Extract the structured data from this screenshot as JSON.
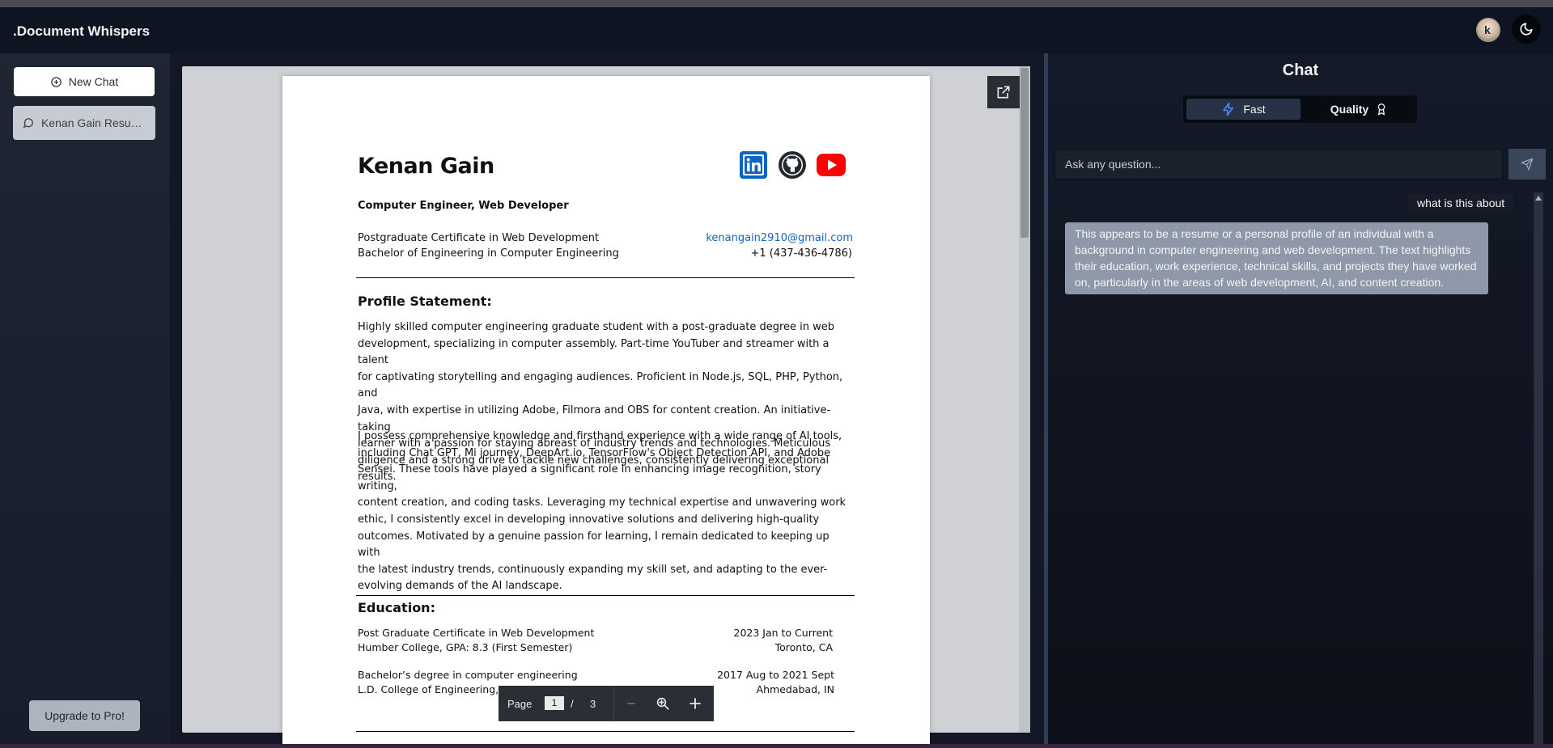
{
  "app": {
    "title": ".Document Whispers",
    "avatar_initial": "k"
  },
  "sidebar": {
    "new_chat_label": "New Chat",
    "chats": [
      {
        "label": "Kenan Gain Resume.pdf"
      }
    ],
    "upgrade_label": "Upgrade to Pro!"
  },
  "document": {
    "name": "Kenan Gain",
    "role": "Computer Engineer, Web Developer",
    "degree_1": "Postgraduate Certificate in Web Development",
    "degree_2": "Bachelor of Engineering in Computer Engineering",
    "email": "kenangain2910@gmail.com",
    "phone": "+1 (437-436-4786)",
    "social_icons": [
      "linkedin-icon",
      "github-icon",
      "youtube-icon"
    ],
    "profile_heading": "Profile Statement:",
    "profile_lines_1": [
      "Highly skilled computer engineering graduate student with a post-graduate degree in web",
      "development, specializing in computer assembly. Part-time YouTuber and streamer with a talent",
      "for captivating storytelling and engaging audiences. Proficient in Node.js, SQL, PHP, Python, and",
      "Java, with expertise in utilizing Adobe, Filmora and OBS for content creation. An initiative-taking",
      "learner with a passion for staying abreast of industry trends and technologies. Meticulous",
      "diligence and a strong drive to tackle new challenges, consistently delivering exceptional results."
    ],
    "profile_lines_2": [
      "I possess comprehensive knowledge and firsthand experience with a wide range of AI tools,",
      "including Chat GPT, Mi journey, DeepArt.io, TensorFlow's Object Detection API, and Adobe",
      "Sensei. These tools have played a significant role in enhancing image recognition, story writing,",
      "content creation, and coding tasks. Leveraging my technical expertise and unwavering work",
      "ethic, I consistently excel in developing innovative solutions and delivering high-quality",
      "outcomes. Motivated by a genuine passion for learning, I remain dedicated to keeping up with",
      "the latest industry trends, continuously expanding my skill set, and adapting to the ever-",
      "evolving demands of the AI landscape."
    ],
    "education_heading": "Education:",
    "education": [
      {
        "title": "Post Graduate Certificate in Web Development",
        "school": "Humber College, GPA: 8.3 (First Semester)",
        "dates": "2023 Jan to Current",
        "location": "Toronto, CA"
      },
      {
        "title": "Bachelor’s degree in computer engineering",
        "school": "L.D. College of Engineering, GPA: 8.07",
        "dates": "2017 Aug to 2021 Sept",
        "location": "Ahmedabad, IN"
      }
    ]
  },
  "pager": {
    "label": "Page",
    "current": "1",
    "separator": "/",
    "total": "3"
  },
  "chat": {
    "title": "Chat",
    "mode_fast": "Fast",
    "mode_quality": "Quality",
    "input_placeholder": "Ask any question...",
    "messages": [
      {
        "role": "user",
        "text": "what is this about"
      },
      {
        "role": "assistant",
        "text": "This appears to be a resume or a personal profile of an individual with a background in computer engineering and web development. The text highlights their education, work experience, technical skills, and projects they have worked on, particularly in the areas of web development, AI, and content creation."
      }
    ]
  },
  "colors": {
    "accent_link": "#1a62b5",
    "assistant_bubble": "#8e98a8",
    "fast_icon": "#4d8cf0"
  }
}
